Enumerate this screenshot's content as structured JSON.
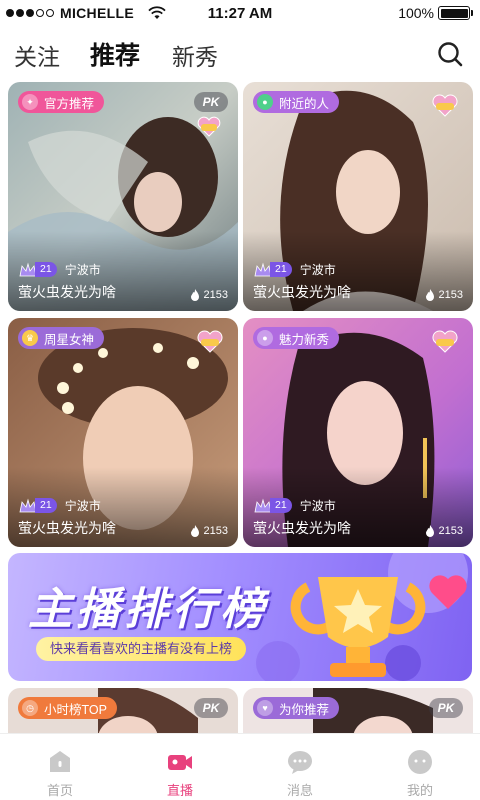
{
  "status_bar": {
    "carrier": "MICHELLE",
    "time": "11:27 AM",
    "battery": "100%",
    "signal_dots_filled": 3,
    "signal_dots_total": 5
  },
  "tabs": [
    {
      "label": "关注"
    },
    {
      "label": "推荐",
      "active": true
    },
    {
      "label": "新秀"
    }
  ],
  "cards": [
    {
      "tag": "官方推荐",
      "tag_color": "#f0569a",
      "pk": "PK",
      "level": "21",
      "city": "宁波市",
      "title": "萤火虫发光为啥",
      "heat": "2153"
    },
    {
      "tag": "附近的人",
      "tag_color": "#b06be0",
      "level": "21",
      "city": "宁波市",
      "title": "萤火虫发光为啥",
      "heat": "2153"
    },
    {
      "tag": "周星女神",
      "tag_color": "#9b6bd8",
      "level": "21",
      "city": "宁波市",
      "title": "萤火虫发光为啥",
      "heat": "2153"
    },
    {
      "tag": "魅力新秀",
      "tag_color": "#b06be0",
      "level": "21",
      "city": "宁波市",
      "title": "萤火虫发光为啥",
      "heat": "2153"
    }
  ],
  "banner": {
    "headline": "主播排行榜",
    "subtitle": "快来看看喜欢的主播有没有上榜"
  },
  "bottom_cards": [
    {
      "tag": "小时榜TOP",
      "tag_color": "#f07a3c",
      "pk": "PK"
    },
    {
      "tag": "为你推荐",
      "tag_color": "#9b6bd8",
      "pk": "PK"
    }
  ],
  "bottom_nav": [
    {
      "label": "首页",
      "icon": "home-icon"
    },
    {
      "label": "直播",
      "icon": "live-camera-icon",
      "active": true
    },
    {
      "label": "消息",
      "icon": "chat-icon"
    },
    {
      "label": "我的",
      "icon": "profile-icon"
    }
  ],
  "colors": {
    "accent": "#e8417d",
    "banner": "#a38fff"
  }
}
